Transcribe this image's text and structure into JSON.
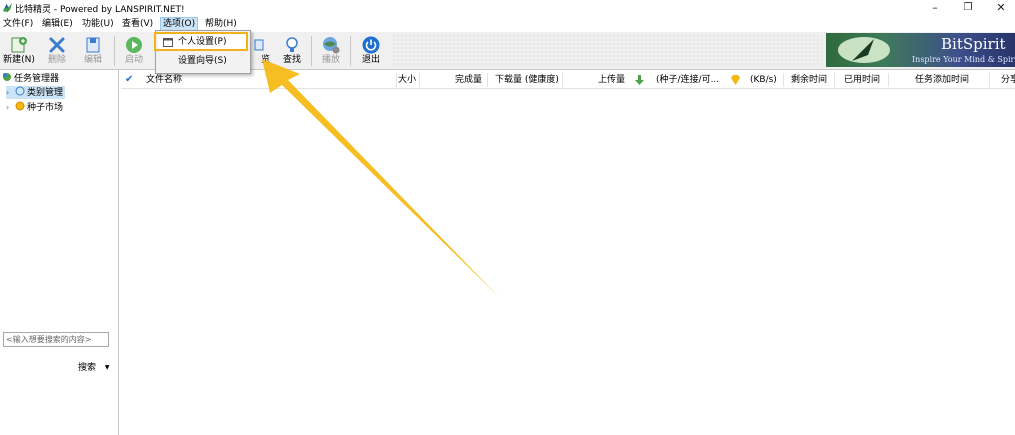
{
  "window": {
    "title": "比特精灵 - Powered by LANSPIRIT.NET!",
    "controls": {
      "minimize": "–",
      "maximize": "❐",
      "close": "✕"
    }
  },
  "menubar": [
    {
      "label": "文件(F)"
    },
    {
      "label": "编辑(E)"
    },
    {
      "label": "功能(U)"
    },
    {
      "label": "查看(V)"
    },
    {
      "label": "选项(O)",
      "active": true
    },
    {
      "label": "帮助(H)"
    }
  ],
  "toolbar": {
    "new": "新建(N)",
    "delete": "删除",
    "edit": "编辑",
    "start": "启动",
    "find": "查找",
    "play": "播放",
    "exit": "退出",
    "partial_label": "览"
  },
  "dropdown": {
    "items": [
      {
        "label": "个人设置(P)",
        "highlighted": true
      },
      {
        "label": "设置向导(S)"
      }
    ]
  },
  "banner": {
    "title": "BitSpirit",
    "slogan": "Inspire Your Mind & Spirit"
  },
  "tree": {
    "root": "任务管理器",
    "items": [
      {
        "label": "类别管理",
        "selected": true
      },
      {
        "label": "种子市场"
      }
    ]
  },
  "search": {
    "placeholder": "<输入想要搜索的内容>",
    "button": "搜索",
    "dropdown_icon": "▼"
  },
  "list_columns": [
    "✔",
    "文件名称",
    "大小",
    "完成量",
    "下载量 (健康度)",
    "上传量",
    "(种子/连接/可...",
    "(KB/s)",
    "剩余时间",
    "已用时间",
    "任务添加时间",
    "分享"
  ],
  "colors": {
    "highlight_border": "#f3b21a",
    "arrow": "#f5b80f",
    "selection": "#cce4f7"
  }
}
